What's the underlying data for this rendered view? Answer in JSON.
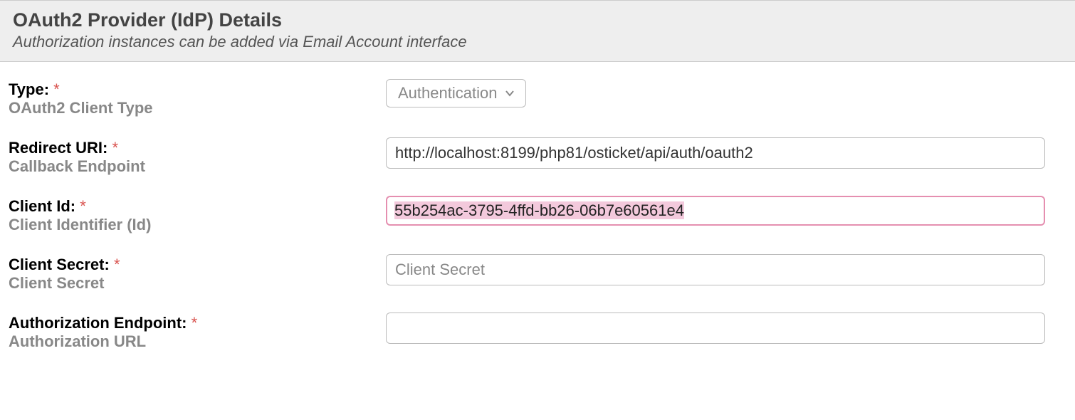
{
  "header": {
    "title": "OAuth2 Provider (IdP) Details",
    "subtitle": "Authorization instances can be added via Email Account interface"
  },
  "fields": {
    "type": {
      "label": "Type:",
      "required_mark": "*",
      "hint": "OAuth2 Client Type",
      "selected": "Authentication"
    },
    "redirect_uri": {
      "label": "Redirect URI:",
      "required_mark": "*",
      "hint": "Callback Endpoint",
      "value": "http://localhost:8199/php81/osticket/api/auth/oauth2"
    },
    "client_id": {
      "label": "Client Id:",
      "required_mark": "*",
      "hint": "Client Identifier (Id)",
      "value": "55b254ac-3795-4ffd-bb26-06b7e60561e4"
    },
    "client_secret": {
      "label": "Client Secret:",
      "required_mark": "*",
      "hint": "Client Secret",
      "placeholder": "Client Secret",
      "value": ""
    },
    "auth_endpoint": {
      "label": "Authorization Endpoint:",
      "required_mark": "*",
      "hint": "Authorization URL",
      "value": ""
    }
  }
}
